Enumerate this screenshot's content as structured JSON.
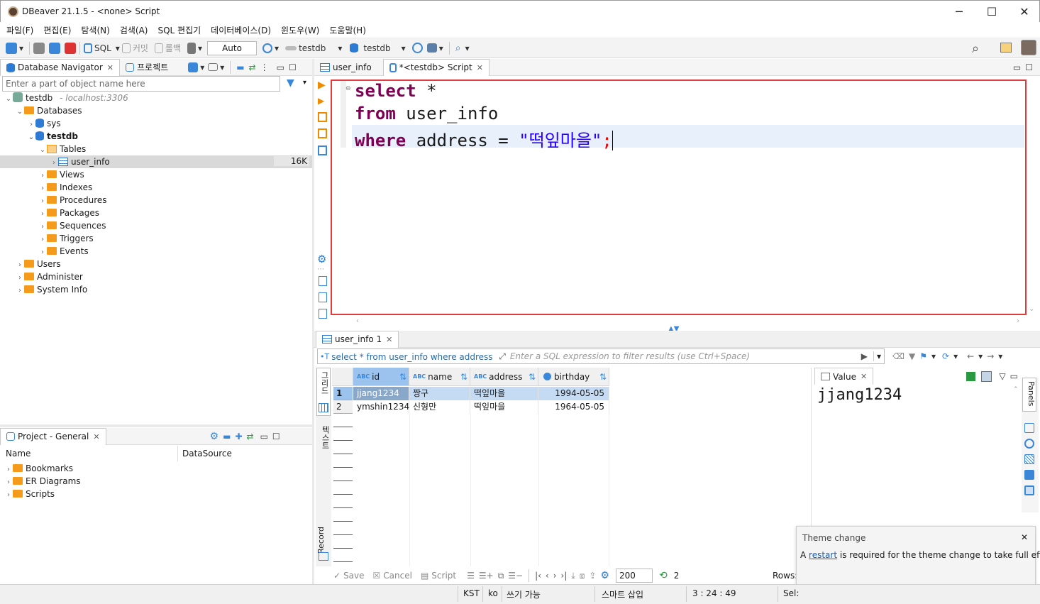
{
  "window": {
    "title": "DBeaver 21.1.5 - <none> Script",
    "min": "─",
    "max": "☐",
    "close": "✕"
  },
  "menu": [
    "파일(F)",
    "편집(E)",
    "탐색(N)",
    "검색(A)",
    "SQL 편집기",
    "데이터베이스(D)",
    "윈도우(W)",
    "도움말(H)"
  ],
  "toolbar": {
    "sql": "SQL",
    "commit": "커밋",
    "rollback": "롤백",
    "auto": "Auto",
    "ds1": "testdb",
    "ds2": "testdb"
  },
  "navigator": {
    "tab_label": "Database Navigator",
    "project_tab": "프로젝트",
    "filter_placeholder": "Enter a part of object name here",
    "connection": "testdb",
    "connection_host": "- localhost:3306",
    "items": {
      "databases": "Databases",
      "sys": "sys",
      "testdb": "testdb",
      "tables": "Tables",
      "user_info": "user_info",
      "user_info_size": "16K",
      "views": "Views",
      "indexes": "Indexes",
      "procedures": "Procedures",
      "packages": "Packages",
      "sequences": "Sequences",
      "triggers": "Triggers",
      "events": "Events",
      "users": "Users",
      "administer": "Administer",
      "system_info": "System Info"
    }
  },
  "project": {
    "tab_label": "Project - General",
    "col_name": "Name",
    "col_datasource": "DataSource",
    "items": [
      "Bookmarks",
      "ER Diagrams",
      "Scripts"
    ]
  },
  "editor": {
    "tab1": "user_info",
    "tab2": "*<testdb> Script",
    "line1_kw": "select",
    "line1_rest": " *",
    "line2_kw": "from",
    "line2_rest": " user_info",
    "line3_kw": "where",
    "line3_mid": " address = ",
    "line3_str": "\"떡잎마을\"",
    "line3_end": ";"
  },
  "results": {
    "tab_label": "user_info 1",
    "query_text": "select * from user_info where address = \"떡",
    "filter_placeholder": "Enter a SQL expression to filter results (use Ctrl+Space)",
    "columns": [
      "id",
      "name",
      "address",
      "birthday"
    ],
    "rows": [
      {
        "n": "1",
        "id": "jjang1234",
        "name": "짱구",
        "address": "떡잎마을",
        "birthday": "1994-05-05"
      },
      {
        "n": "2",
        "id": "ymshin1234",
        "name": "신형만",
        "address": "떡잎마을",
        "birthday": "1964-05-05"
      }
    ],
    "side_grid": "그리드",
    "side_text": "텍스트",
    "side_record": "Record",
    "save": "Save",
    "cancel": "Cancel",
    "script": "Script",
    "fetch_size": "200",
    "count": "2",
    "rows_label": "Rows:"
  },
  "value_panel": {
    "tab_label": "Value",
    "value": "jjang1234",
    "panels_label": "Panels"
  },
  "notification": {
    "title": "Theme change",
    "prefix": "A ",
    "link": "restart",
    "suffix": " is required for the theme change to take full effect."
  },
  "status": {
    "tz": "KST",
    "lang": "ko",
    "writable": "쓰기 가능",
    "insert": "스마트 삽입",
    "pos": "3 : 24 : 49",
    "sel": "Sel:"
  }
}
